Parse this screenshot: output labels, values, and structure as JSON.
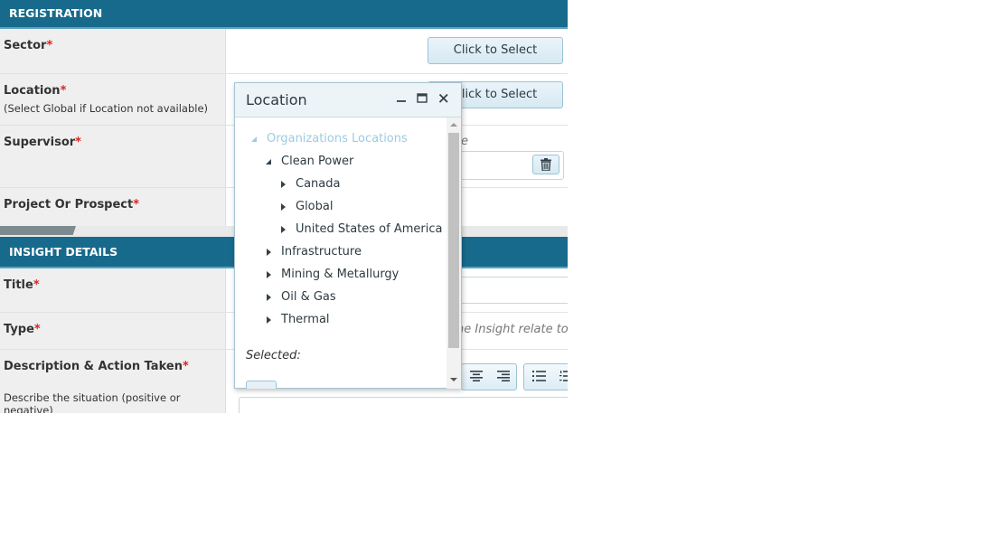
{
  "registration": {
    "header": "REGISTRATION",
    "sector": {
      "label": "Sector",
      "required": "*",
      "button": "Click to Select"
    },
    "location": {
      "label": "Location",
      "required": "*",
      "note": "(Select Global if Location not available)",
      "button": "Click to Select"
    },
    "supervisor": {
      "label": "Supervisor",
      "required": "*",
      "hint_fragment": "e"
    },
    "project": {
      "label": "Project Or Prospect",
      "required": "*"
    }
  },
  "insight": {
    "header": "INSIGHT DETAILS",
    "title": {
      "label": "Title",
      "required": "*"
    },
    "type": {
      "label": "Type",
      "required": "*",
      "hint_fragment": "he Insight relate to a"
    },
    "description": {
      "label": "Description & Action Taken",
      "required": "*",
      "note": "Describe the situation (positive or negative)"
    }
  },
  "location_popup": {
    "title": "Location",
    "tree": {
      "root": "Organizations Locations",
      "clean_power": "Clean Power",
      "canada": "Canada",
      "global": "Global",
      "usa": "United States of America",
      "infrastructure": "Infrastructure",
      "mining": "Mining & Metallurgy",
      "oil_gas": "Oil & Gas",
      "thermal": "Thermal"
    },
    "selected_label": "Selected:"
  },
  "colors": {
    "header_bg": "#186a8c",
    "required": "#dd2222",
    "root_node": "#9dcbe0"
  }
}
